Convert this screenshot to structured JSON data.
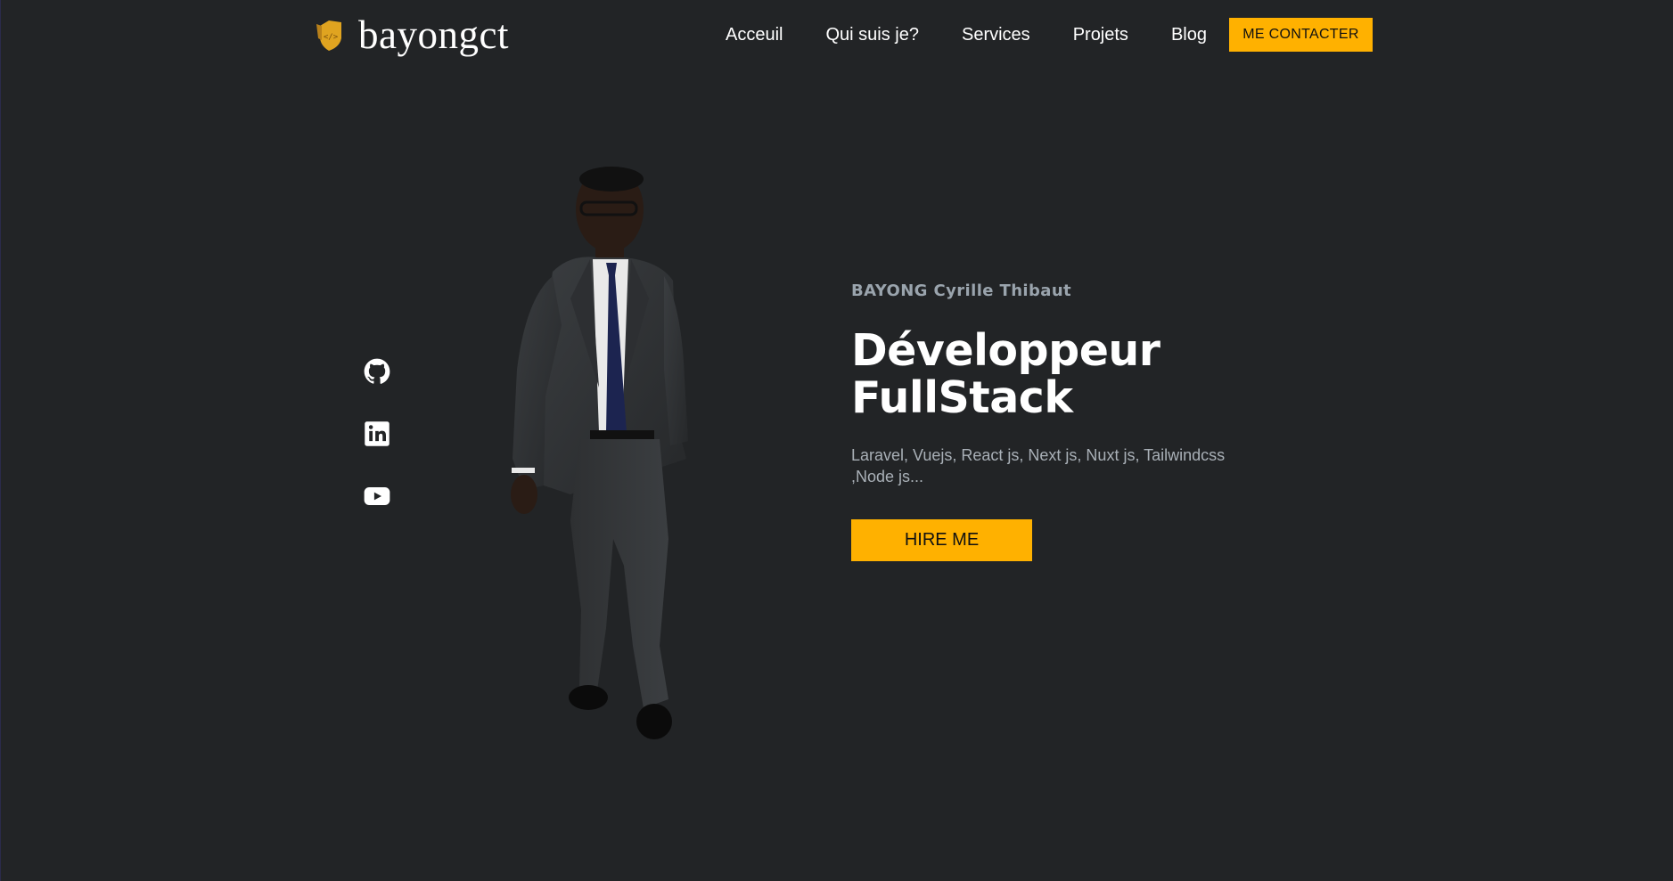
{
  "brand": {
    "name": "bayongct",
    "icon": "code-shield-logo-icon",
    "icon_color": "#e0a420"
  },
  "nav": {
    "items": [
      {
        "label": "Acceuil"
      },
      {
        "label": "Qui suis je?"
      },
      {
        "label": "Services"
      },
      {
        "label": "Projets"
      },
      {
        "label": "Blog"
      }
    ],
    "cta_label": "ME CONTACTER"
  },
  "social": [
    {
      "icon": "github-icon"
    },
    {
      "icon": "linkedin-icon"
    },
    {
      "icon": "youtube-icon"
    }
  ],
  "hero": {
    "name": "BAYONG Cyrille Thibaut",
    "title_line1": "Développeur",
    "title_line2": "FullStack",
    "skills": "Laravel, Vuejs, React js, Next js, Nuxt js, Tailwindcss ,Node js...",
    "cta_label": "HIRE ME",
    "portrait": "developer-portrait-photo"
  },
  "colors": {
    "background": "#222426",
    "accent": "#ffb100",
    "muted_text": "#9aa4ad"
  }
}
